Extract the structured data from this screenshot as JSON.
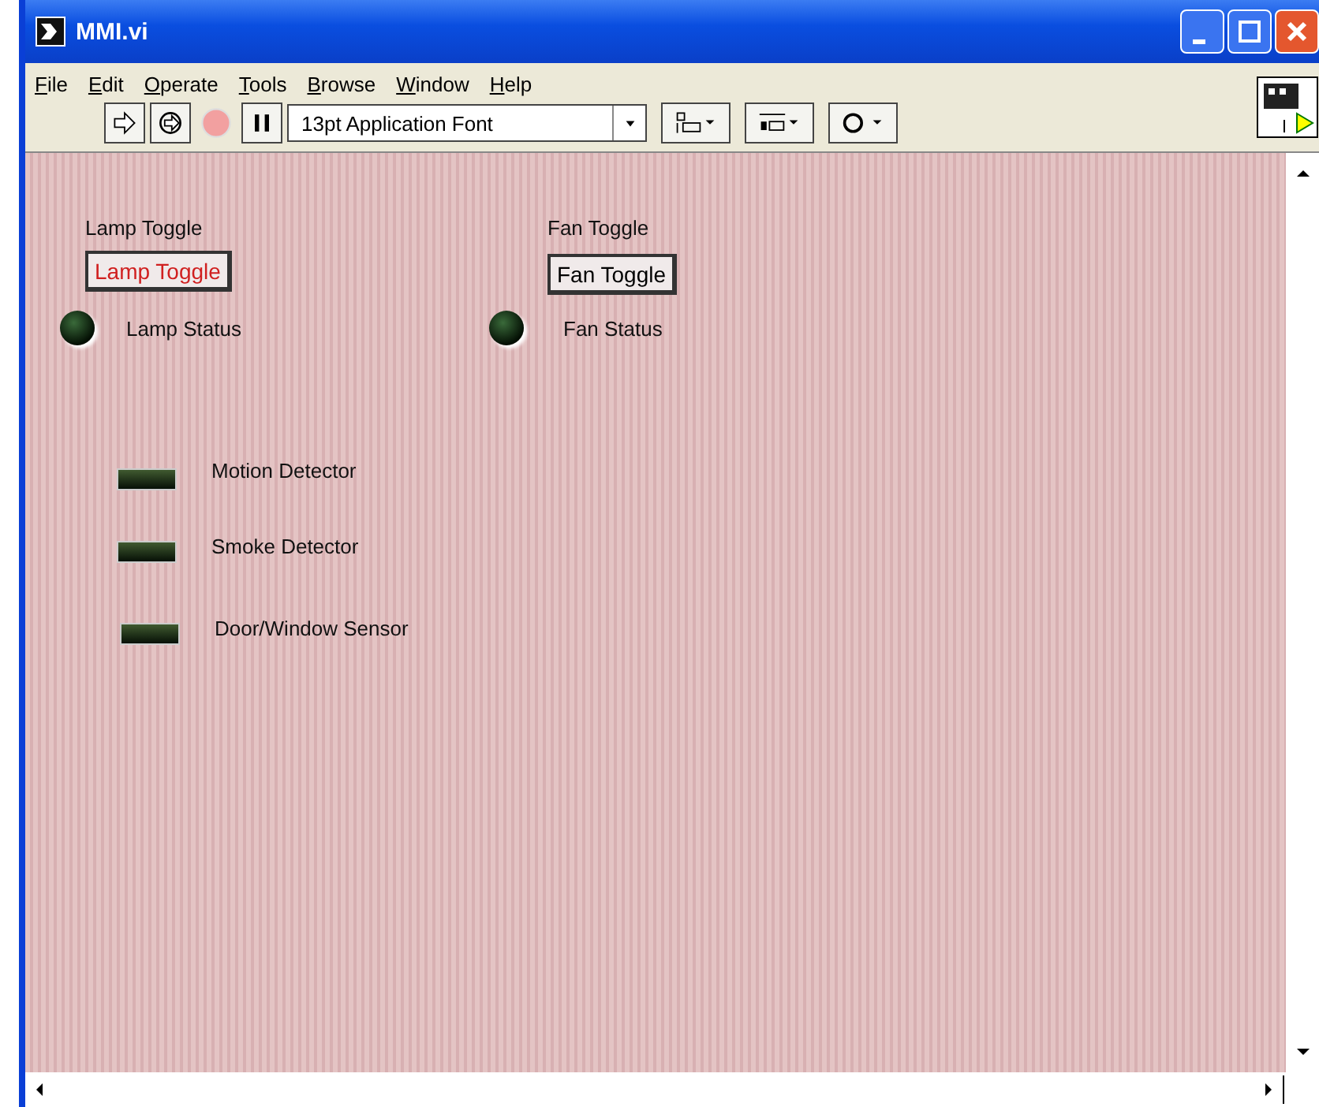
{
  "window": {
    "title": "MMI.vi"
  },
  "menu": [
    {
      "label": "File"
    },
    {
      "label": "Edit"
    },
    {
      "label": "Operate"
    },
    {
      "label": "Tools"
    },
    {
      "label": "Browse"
    },
    {
      "label": "Window"
    },
    {
      "label": "Help"
    }
  ],
  "toolbar": {
    "font": "13pt Application Font"
  },
  "panel": {
    "controls": [
      {
        "kind": "button",
        "label": "Lamp Toggle",
        "text": "Lamp Toggle",
        "on": true
      },
      {
        "kind": "button",
        "label": "Fan Toggle",
        "text": "Fan Toggle",
        "on": false
      },
      {
        "kind": "round-led",
        "label": "Lamp Status",
        "on": false
      },
      {
        "kind": "round-led",
        "label": "Fan Status",
        "on": false
      },
      {
        "kind": "square-led",
        "label": "Motion Detector",
        "on": false
      },
      {
        "kind": "square-led",
        "label": "Smoke Detector",
        "on": false
      },
      {
        "kind": "square-led",
        "label": "Door/Window Sensor",
        "on": false
      }
    ]
  }
}
